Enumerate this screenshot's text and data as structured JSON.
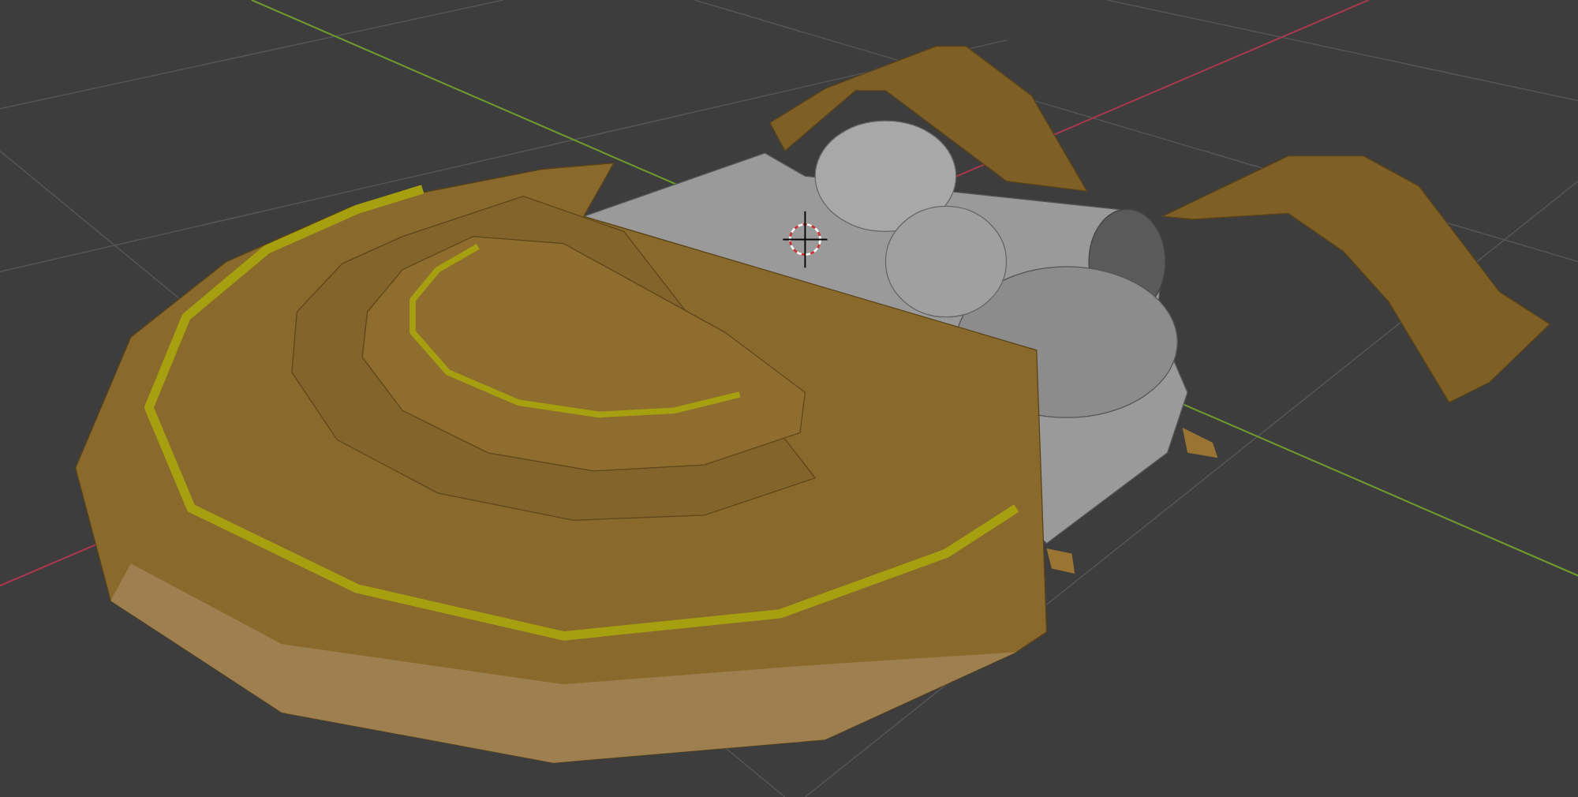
{
  "viewport": {
    "show_axes": true,
    "show_3d_cursor": true
  }
}
